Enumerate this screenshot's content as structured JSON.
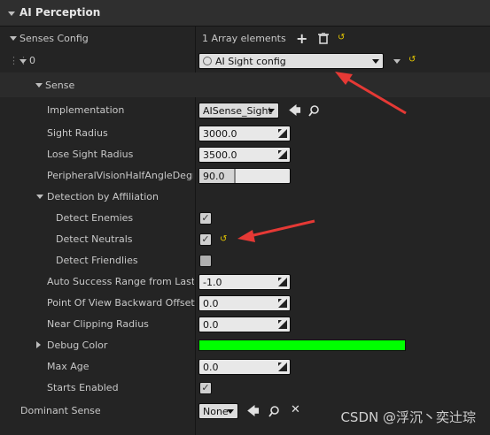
{
  "header": {
    "title": "AI Perception"
  },
  "senses_config": {
    "label": "Senses Config",
    "array_text": "1 Array elements",
    "index_label": "0",
    "selected_config": "AI Sight config"
  },
  "sense": {
    "label": "Sense",
    "implementation_label": "Implementation",
    "implementation_value": "AISense_Sight",
    "sight_radius_label": "Sight Radius",
    "sight_radius_value": "3000.0",
    "lose_sight_radius_label": "Lose Sight Radius",
    "lose_sight_radius_value": "3500.0",
    "peripheral_label": "PeripheralVisionHalfAngleDegree",
    "peripheral_value": "90.0",
    "peripheral_fill": 0.4,
    "detection_label": "Detection by Affiliation",
    "detect_enemies_label": "Detect Enemies",
    "detect_enemies": true,
    "detect_neutrals_label": "Detect Neutrals",
    "detect_neutrals": true,
    "detect_friendlies_label": "Detect Friendlies",
    "detect_friendlies": false,
    "auto_success_label": "Auto Success Range from Last S",
    "auto_success_value": "-1.0",
    "pov_label": "Point Of View Backward Offset",
    "pov_value": "0.0",
    "near_clip_label": "Near Clipping Radius",
    "near_clip_value": "0.0",
    "debug_color_label": "Debug Color",
    "debug_color": "#00ff00",
    "max_age_label": "Max Age",
    "max_age_value": "0.0",
    "starts_enabled_label": "Starts Enabled",
    "starts_enabled": true
  },
  "dominant_sense": {
    "label": "Dominant Sense",
    "value": "None"
  },
  "watermark": "CSDN @浮沉丶奕辻琮",
  "colors": {
    "arrow": "#e53935",
    "reset": "#e6c800"
  }
}
